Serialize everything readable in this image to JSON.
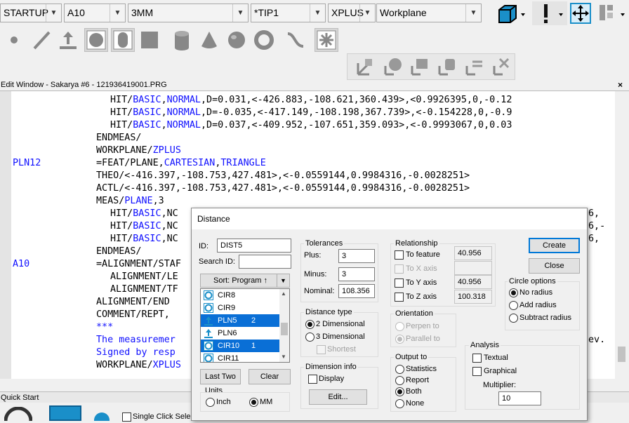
{
  "toolbar": {
    "combos": [
      {
        "name": "startup-combo",
        "value": "STARTUP"
      },
      {
        "name": "alignment-combo",
        "value": "A10"
      },
      {
        "name": "probe-combo",
        "value": "3MM"
      },
      {
        "name": "tip-combo",
        "value": "*TIP1"
      },
      {
        "name": "direction-combo",
        "value": "XPLUS"
      },
      {
        "name": "workplane-combo",
        "value": "Workplane"
      }
    ]
  },
  "edit_window": {
    "title": "Edit Window - Sakarya #6 - 121936419001.PRG",
    "lines": [
      {
        "indent": "        ",
        "parts": [
          [
            "HIT/",
            ""
          ],
          [
            "BASIC",
            "kw"
          ],
          [
            ",",
            ""
          ],
          [
            "NORMAL",
            "kw"
          ],
          [
            ",D=0.031,<-426.883,-108.621,360.439>,<0.9926395,0,-0.12",
            ""
          ]
        ]
      },
      {
        "indent": "        ",
        "parts": [
          [
            "HIT/",
            ""
          ],
          [
            "BASIC",
            "kw"
          ],
          [
            ",",
            ""
          ],
          [
            "NORMAL",
            "kw"
          ],
          [
            ",D=-0.035,<-417.149,-108.198,367.739>,<-0.154228,0,-0.9",
            ""
          ]
        ]
      },
      {
        "indent": "        ",
        "parts": [
          [
            "HIT/",
            ""
          ],
          [
            "BASIC",
            "kw"
          ],
          [
            ",",
            ""
          ],
          [
            "NORMAL",
            "kw"
          ],
          [
            ",D=0.037,<-409.952,-107.651,359.093>,<-0.9993067,0,0.03",
            ""
          ]
        ]
      },
      {
        "indent": "      ",
        "parts": [
          [
            "ENDMEAS/",
            ""
          ]
        ]
      },
      {
        "indent": "      ",
        "parts": [
          [
            "WORKPLANE/",
            ""
          ],
          [
            "ZPLUS",
            "kw"
          ]
        ]
      },
      {
        "label": "PLN12",
        "indent": "      ",
        "parts": [
          [
            "=FEAT/PLANE,",
            ""
          ],
          [
            "CARTESIAN",
            "kw"
          ],
          [
            ",",
            ""
          ],
          [
            "TRIANGLE",
            "kw"
          ]
        ]
      },
      {
        "indent": "      ",
        "parts": [
          [
            "THEO/<-416.397,-108.753,427.481>,<-0.0559144,0.9984316,-0.0028251>",
            ""
          ]
        ]
      },
      {
        "indent": "      ",
        "parts": [
          [
            "ACTL/<-416.397,-108.753,427.481>,<-0.0559144,0.9984316,-0.0028251>",
            ""
          ]
        ]
      },
      {
        "indent": "      ",
        "parts": [
          [
            "MEAS/",
            ""
          ],
          [
            "PLANE",
            "kw"
          ],
          [
            ",3",
            ""
          ]
        ]
      },
      {
        "indent": "        ",
        "parts": [
          [
            "HIT/",
            ""
          ],
          [
            "BASIC",
            "kw"
          ],
          [
            ",NC",
            ""
          ]
        ],
        "tail": "6,"
      },
      {
        "indent": "        ",
        "parts": [
          [
            "HIT/",
            ""
          ],
          [
            "BASIC",
            "kw"
          ],
          [
            ",NC",
            ""
          ]
        ],
        "tail": "6,-"
      },
      {
        "indent": "        ",
        "parts": [
          [
            "HIT/",
            ""
          ],
          [
            "BASIC",
            "kw"
          ],
          [
            ",NC",
            ""
          ]
        ],
        "tail": "6,"
      },
      {
        "indent": "      ",
        "parts": [
          [
            "ENDMEAS/",
            ""
          ]
        ]
      },
      {
        "label": "A10",
        "indent": "      ",
        "parts": [
          [
            "=ALIGNMENT/STAF",
            ""
          ]
        ]
      },
      {
        "indent": "        ",
        "parts": [
          [
            "ALIGNMENT/LE",
            ""
          ]
        ]
      },
      {
        "indent": "        ",
        "parts": [
          [
            "ALIGNMENT/TF",
            ""
          ]
        ]
      },
      {
        "indent": "      ",
        "parts": [
          [
            "ALIGNMENT/END",
            ""
          ]
        ]
      },
      {
        "indent": "      ",
        "parts": [
          [
            "COMMENT/REPT,",
            ""
          ]
        ]
      },
      {
        "indent": "      ",
        "parts": [
          [
            "***",
            "kw"
          ]
        ]
      },
      {
        "indent": "      ",
        "parts": [
          [
            "The measuremer",
            "kw"
          ]
        ],
        "tail": "ev."
      },
      {
        "indent": "      ",
        "parts": [
          [
            "Signed by resp",
            "kw"
          ]
        ]
      },
      {
        "indent": "      ",
        "parts": [
          [
            "WORKPLANE/",
            ""
          ],
          [
            "XPLUS",
            "kw"
          ]
        ]
      }
    ]
  },
  "quick_start": {
    "title": "Quick Start",
    "single_click_label": "Single Click Select"
  },
  "dialog": {
    "title": "Distance",
    "id_label": "ID:",
    "id_value": "DIST5",
    "search_label": "Search ID:",
    "search_value": "",
    "sort_label": "Sort: Program ↑",
    "list": [
      {
        "name": "CIR8",
        "type": "circle",
        "num": "",
        "selected": false
      },
      {
        "name": "CIR9",
        "type": "circle",
        "num": "",
        "selected": false
      },
      {
        "name": "PLN5",
        "type": "plane",
        "num": "2",
        "selected": true
      },
      {
        "name": "PLN6",
        "type": "plane",
        "num": "",
        "selected": false
      },
      {
        "name": "CIR10",
        "type": "circle",
        "num": "1",
        "selected": true
      },
      {
        "name": "CIR11",
        "type": "circle",
        "num": "",
        "selected": false
      }
    ],
    "last_two_label": "Last Two",
    "clear_label": "Clear",
    "units": {
      "title": "Units",
      "inch": "Inch",
      "mm": "MM",
      "selected": "MM"
    },
    "tolerances": {
      "title": "Tolerances",
      "plus_label": "Plus:",
      "plus": "3",
      "minus_label": "Minus:",
      "minus": "3",
      "nominal_label": "Nominal:",
      "nominal": "108.356"
    },
    "distance_type": {
      "title": "Distance type",
      "two_d": "2 Dimensional",
      "three_d": "3 Dimensional",
      "shortest": "Shortest",
      "selected": "2 Dimensional"
    },
    "dimension_info": {
      "title": "Dimension info",
      "display": "Display",
      "edit": "Edit..."
    },
    "relationship": {
      "title": "Relationship",
      "to_feature": "To feature",
      "to_feature_val": "40.956",
      "to_x": "To X axis",
      "to_x_val": "",
      "to_y": "To Y axis",
      "to_y_val": "40.956",
      "to_z": "To Z axis",
      "to_z_val": "100.318"
    },
    "orientation": {
      "title": "Orientation",
      "perpen": "Perpen to",
      "parallel": "Parallel to",
      "selected": "Parallel to"
    },
    "output": {
      "title": "Output to",
      "statistics": "Statistics",
      "report": "Report",
      "both": "Both",
      "none": "None",
      "selected": "Both"
    },
    "create_label": "Create",
    "close_label": "Close",
    "circle_options": {
      "title": "Circle options",
      "no_radius": "No radius",
      "add_radius": "Add radius",
      "subtract_radius": "Subtract radius",
      "selected": "No radius"
    },
    "analysis": {
      "title": "Analysis",
      "textual": "Textual",
      "graphical": "Graphical",
      "multiplier_label": "Multiplier:",
      "multiplier": "10"
    }
  },
  "colors": {
    "keyword": "#1010ff",
    "selection": "#0a6fd6",
    "icon_blue": "#1a8fc9"
  }
}
